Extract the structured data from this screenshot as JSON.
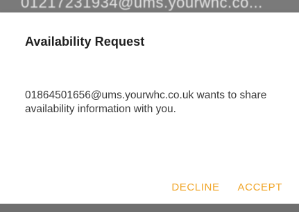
{
  "background": {
    "partial_text": "01217231934@ums.yourwhc.co..."
  },
  "dialog": {
    "title": "Availability Request",
    "message": "01864501656@ums.yourwhc.co.uk wants to share availability information with you.",
    "actions": {
      "decline_label": "DECLINE",
      "accept_label": "ACCEPT"
    },
    "accent_color": "#f0a527"
  }
}
